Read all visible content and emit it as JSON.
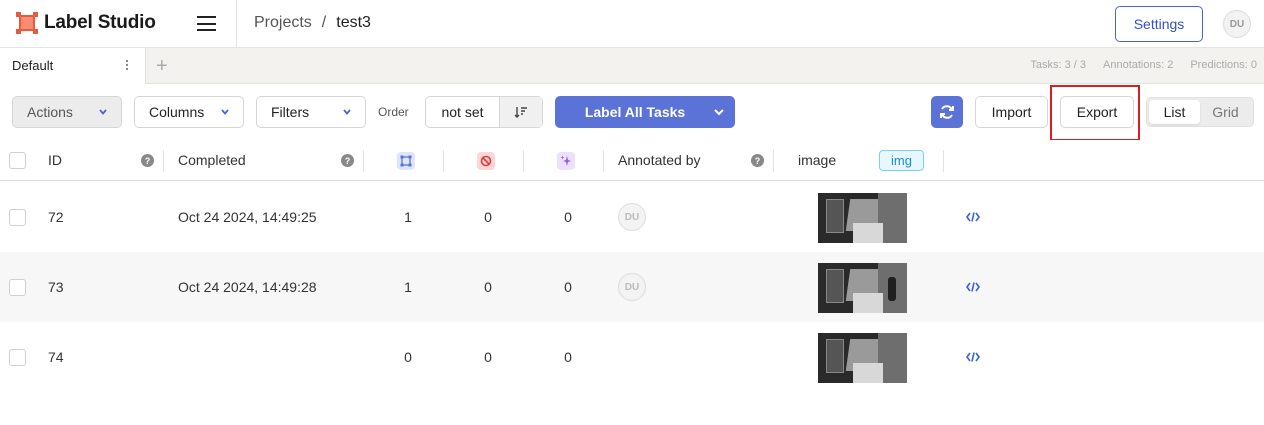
{
  "app": {
    "name": "Label Studio"
  },
  "breadcrumb": {
    "projects": "Projects",
    "separator": "/",
    "current": "test3"
  },
  "header": {
    "settings_label": "Settings",
    "user_initials": "DU"
  },
  "tabs": [
    {
      "label": "Default"
    }
  ],
  "stats": {
    "tasks": "Tasks: 3 / 3",
    "annotations": "Annotations: 2",
    "predictions": "Predictions: 0"
  },
  "toolbar": {
    "actions_label": "Actions",
    "columns_label": "Columns",
    "filters_label": "Filters",
    "order_label": "Order",
    "order_value": "not set",
    "label_all_label": "Label All Tasks",
    "import_label": "Import",
    "export_label": "Export",
    "view_list": "List",
    "view_grid": "Grid"
  },
  "table": {
    "headers": {
      "id": "ID",
      "completed": "Completed",
      "annotated_by": "Annotated by",
      "image": "image",
      "image_tag": "img"
    },
    "rows": [
      {
        "id": "72",
        "completed": "Oct 24 2024, 14:49:25",
        "annotations": "1",
        "cancelled": "0",
        "predictions": "0",
        "annotator": "DU"
      },
      {
        "id": "73",
        "completed": "Oct 24 2024, 14:49:28",
        "annotations": "1",
        "cancelled": "0",
        "predictions": "0",
        "annotator": "DU"
      },
      {
        "id": "74",
        "completed": "",
        "annotations": "0",
        "cancelled": "0",
        "predictions": "0",
        "annotator": ""
      }
    ]
  },
  "colors": {
    "accent": "#5b73d6",
    "highlight": "#d81e1e",
    "logo": "#e85a3c"
  }
}
